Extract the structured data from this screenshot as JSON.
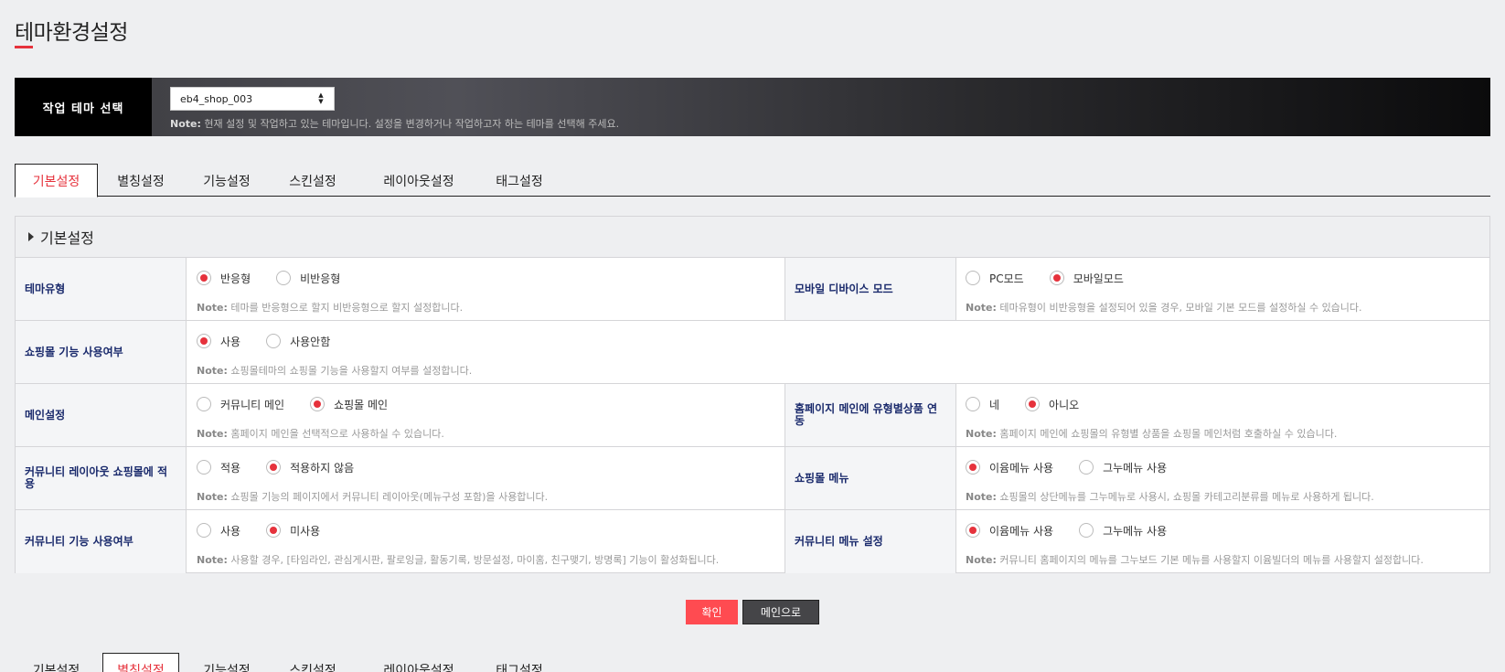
{
  "page_title": "테마환경설정",
  "theme_bar": {
    "label": "작업 테마 선택",
    "selected_theme": "eb4_shop_003",
    "note_label": "Note:",
    "note_text": " 현재 설정 및 작업하고 있는 테마입니다. 설정을 변경하거나 작업하고자 하는 테마를 선택해 주세요."
  },
  "tabs": [
    "기본설정",
    "별칭설정",
    "기능설정",
    "스킨설정",
    "레이아웃설정",
    "태그설정"
  ],
  "section_title": "기본설정",
  "note_prefix": "Note:",
  "rows": [
    {
      "left": {
        "label": "테마유형",
        "options": [
          "반응형",
          "비반응형"
        ],
        "selected": 0,
        "note": " 테마를 반응형으로 할지 비반응형으로 할지 설정합니다."
      },
      "right": {
        "label": "모바일 디바이스 모드",
        "options": [
          "PC모드",
          "모바일모드"
        ],
        "selected": 1,
        "note": " 테마유형이 비반응형을 설정되어 있을 경우, 모바일 기본 모드를 설정하실 수 있습니다."
      }
    },
    {
      "left": {
        "label": "쇼핑몰 기능 사용여부",
        "options": [
          "사용",
          "사용안함"
        ],
        "selected": 0,
        "note": " 쇼핑몰테마의 쇼핑몰 기능을 사용할지 여부를 설정합니다."
      }
    },
    {
      "left": {
        "label": "메인설정",
        "options": [
          "커뮤니티 메인",
          "쇼핑몰 메인"
        ],
        "selected": 1,
        "note": " 홈페이지 메인을 선택적으로 사용하실 수 있습니다."
      },
      "right": {
        "label": "홈페이지 메인에 유형별상품 연동",
        "options": [
          "네",
          "아니오"
        ],
        "selected": 1,
        "note": " 홈페이지 메인에 쇼핑몰의 유형별 상품을 쇼핑몰 메인처럼 호출하실 수 있습니다."
      }
    },
    {
      "left": {
        "label": "커뮤니티 레이아웃 쇼핑몰에 적용",
        "options": [
          "적용",
          "적용하지 않음"
        ],
        "selected": 1,
        "note": " 쇼핑몰 기능의 페이지에서 커뮤니티 레이아웃(메뉴구성 포함)을 사용합니다."
      },
      "right": {
        "label": "쇼핑몰 메뉴",
        "options": [
          "이윰메뉴 사용",
          "그누메뉴 사용"
        ],
        "selected": 0,
        "note": " 쇼핑몰의 상단메뉴를 그누메뉴로 사용시, 쇼핑몰 카테고리분류를 메뉴로 사용하게 됩니다."
      }
    },
    {
      "left": {
        "label": "커뮤니티 기능 사용여부",
        "options": [
          "사용",
          "미사용"
        ],
        "selected": 1,
        "note": " 사용할 경우, [타임라인, 관심게시판, 팔로잉글, 활동기록, 방문설정, 마이홈, 친구맺기, 방명록] 기능이 활성화됩니다."
      },
      "right": {
        "label": "커뮤니티 메뉴 설정",
        "options": [
          "이윰메뉴 사용",
          "그누메뉴 사용"
        ],
        "selected": 0,
        "note": " 커뮤니티 홈페이지의 메뉴를 그누보드 기본 메뉴를 사용할지 이윰빌더의 메뉴를 사용할지 설정합니다."
      }
    }
  ],
  "buttons": {
    "confirm": "확인",
    "main": "메인으로"
  },
  "bottom_tabs_active": 1,
  "colors": {
    "accent": "#e6323c",
    "confirm_button": "#ff4b51",
    "label_text": "#1a2a6c"
  }
}
